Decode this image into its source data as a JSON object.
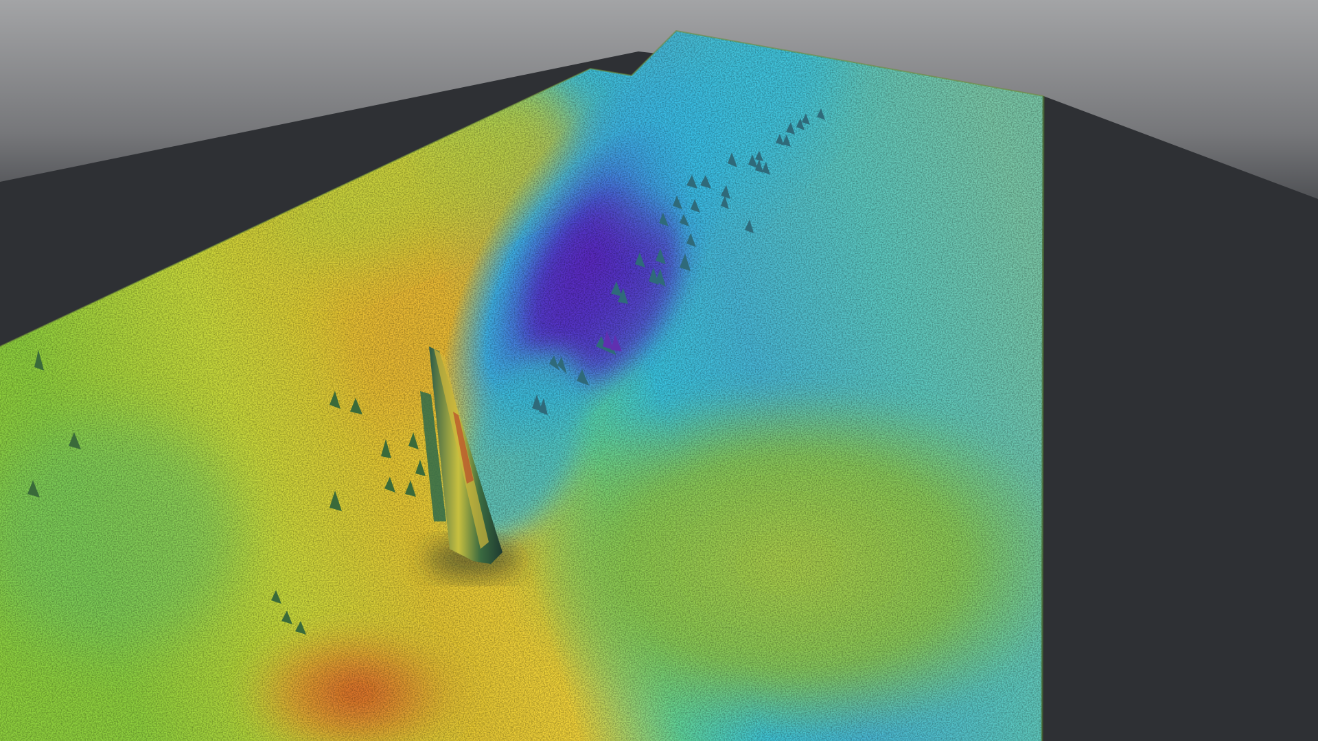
{
  "scene": {
    "type": "3d-bathymetry-render",
    "background_top": "#9d9ea0",
    "background_mid": "#55575b",
    "floor": "#2e3034",
    "colormap": [
      "#d9682a",
      "#e0b832",
      "#d6dc3a",
      "#9fd04a",
      "#4fd0c0",
      "#3fb4e0",
      "#4a62d8",
      "#6a34c8"
    ],
    "labels": []
  }
}
